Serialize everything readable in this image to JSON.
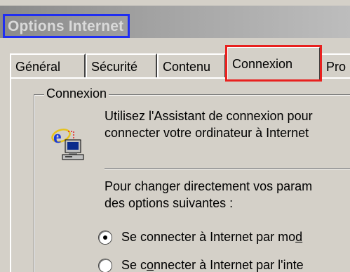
{
  "window": {
    "title": "Options Internet"
  },
  "tabs": [
    {
      "label": "Général"
    },
    {
      "label": "Sécurité"
    },
    {
      "label": "Contenu"
    },
    {
      "label": "Connexion"
    },
    {
      "label": "Pro"
    }
  ],
  "connexion": {
    "group_label": "Connexion",
    "assistant_line1": "Utilisez l'Assistant de connexion pour",
    "assistant_line2": "connecter votre ordinateur à Internet",
    "change_line1": "Pour changer directement vos param",
    "change_line2": "des options suivantes :",
    "radio_modem_pre": "Se connecter à Internet par mo",
    "radio_modem_u": "d",
    "radio_lan_pre": "Se c",
    "radio_lan_u": "o",
    "radio_lan_post": "nnecter à Internet par l'inte",
    "radio_modem_selected": true
  },
  "colors": {
    "title_highlight": "#1f2ef2",
    "active_tab_highlight": "#e8211f",
    "dialog_face": "#d4d0c8"
  },
  "icons": {
    "connection": "ie-computer-icon"
  }
}
